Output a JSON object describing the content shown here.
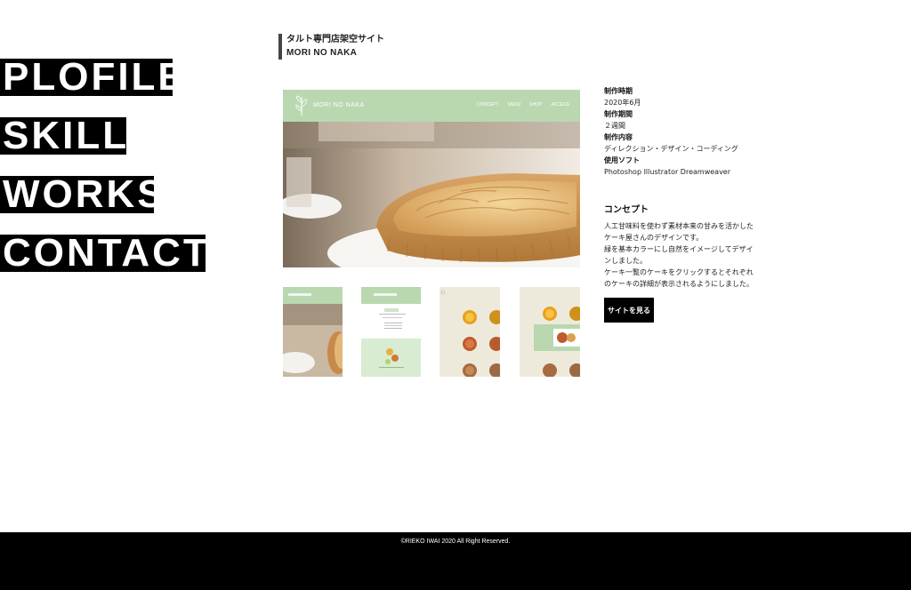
{
  "nav": {
    "items": [
      {
        "label": "PLOFILE"
      },
      {
        "label": "SKILL"
      },
      {
        "label": "WORKS"
      },
      {
        "label": "CONTACT"
      }
    ]
  },
  "work": {
    "kicker": "タルト専門店架空サイト",
    "title": "MORI NO NAKA",
    "preview": {
      "logo_text": "MORI NO NAKA",
      "menu": [
        "CONCEPT",
        "MENU",
        "SHOP",
        "ACCESS"
      ]
    },
    "info": [
      {
        "label": "制作時期",
        "value": "2020年6月"
      },
      {
        "label": "制作期間",
        "value": "２週間"
      },
      {
        "label": "制作内容",
        "value": "ディレクション・デザイン・コーディング"
      },
      {
        "label": "使用ソフト",
        "value": "Photoshop Illustrator Dreamweaver"
      }
    ],
    "concept_title": "コンセプト",
    "concept_lines": [
      "人工甘味料を使わず素材本来の甘みを活かした",
      "ケーキ屋さんのデザインです。",
      "緑を基本カラーにし自然をイメージしてデザイ",
      "ンしました。",
      "ケーキ一覧のケーキをクリックするとそれぞれ",
      "のケーキの詳細が表示されるようにしました。"
    ],
    "button_label": "サイトを見る"
  },
  "footer": {
    "copyright": "©RIEKO IWAI 2020 All Right Reserved."
  },
  "colors": {
    "accent_green": "#b9d8b0",
    "thumb_cream": "#eeeadb",
    "black": "#000000"
  }
}
